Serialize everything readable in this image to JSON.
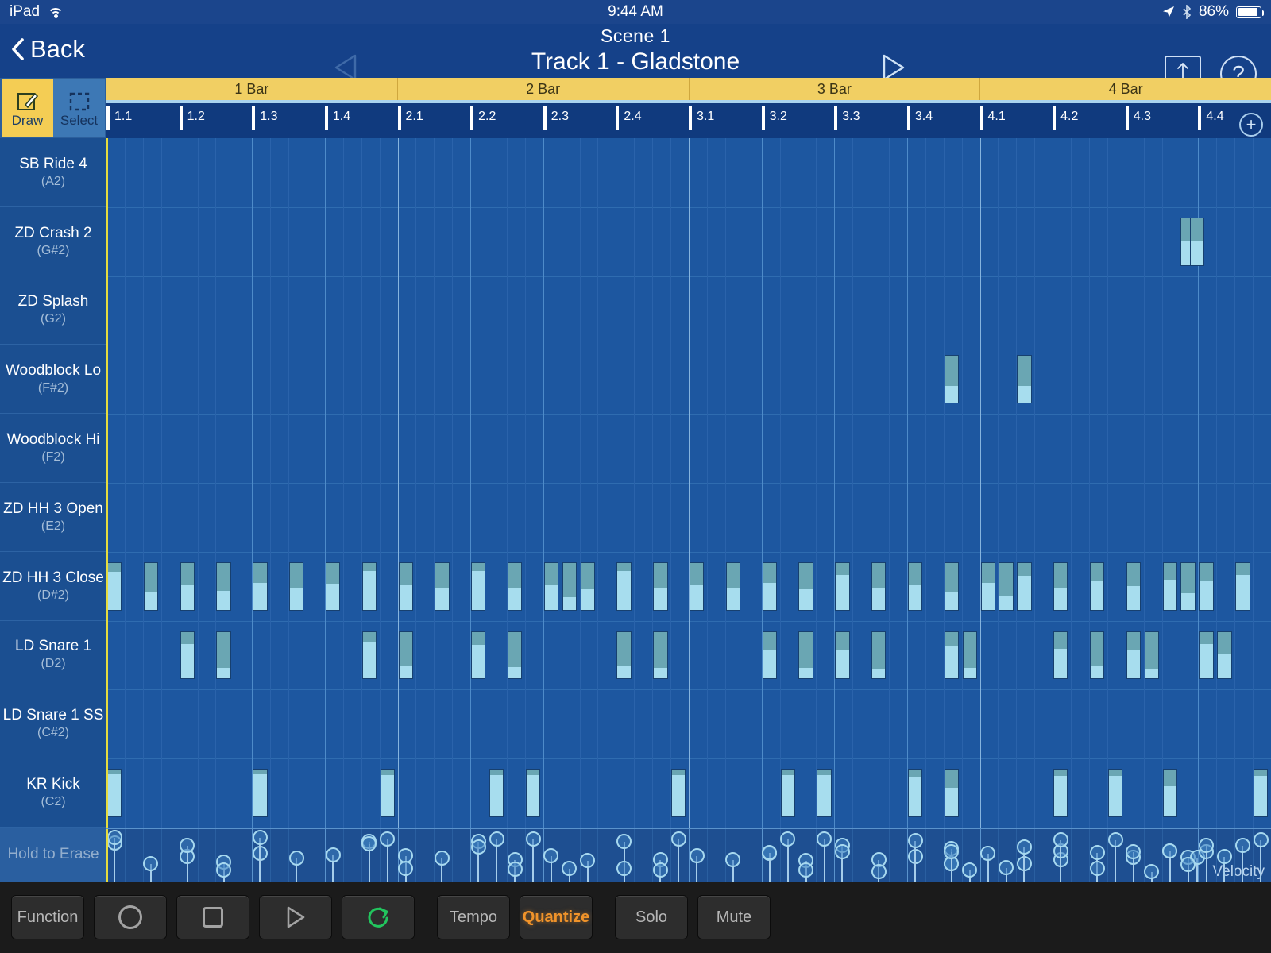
{
  "statusbar": {
    "device": "iPad",
    "wifi_icon": "wifi-icon",
    "time": "9:44 AM",
    "location_icon": "location-arrow-icon",
    "bluetooth_icon": "bluetooth-icon",
    "battery_percent": "86%",
    "battery_level": 86
  },
  "navbar": {
    "back_label": "Back",
    "back_icon": "chevron-left-icon",
    "scene_label": "Scene  1",
    "track_label": "Track 1 - Gladstone",
    "prev_icon": "triangle-left-icon",
    "next_icon": "triangle-right-icon",
    "resize_icon": "vertical-resize-icon",
    "help_icon": "question-mark-icon",
    "help_label": "?"
  },
  "tools": {
    "draw": {
      "label": "Draw",
      "icon": "pencil-square-icon",
      "active": true
    },
    "select": {
      "label": "Select",
      "icon": "dashed-square-icon",
      "active": false
    }
  },
  "ruler": {
    "bars": [
      "1 Bar",
      "2 Bar",
      "3 Bar",
      "4 Bar"
    ],
    "beats": [
      "1.1",
      "1.2",
      "1.3",
      "1.4",
      "2.1",
      "2.2",
      "2.3",
      "2.4",
      "3.1",
      "3.2",
      "3.3",
      "3.4",
      "4.1",
      "4.2",
      "4.3",
      "4.4"
    ],
    "add_label": "+",
    "add_icon": "plus-circle-icon"
  },
  "tracks": [
    {
      "name": "SB Ride 4",
      "note": "(A2)"
    },
    {
      "name": "ZD Crash 2",
      "note": "(G#2)"
    },
    {
      "name": "ZD Splash",
      "note": "(G2)"
    },
    {
      "name": "Woodblock Lo",
      "note": "(F#2)"
    },
    {
      "name": "Woodblock Hi",
      "note": "(F2)"
    },
    {
      "name": "ZD HH 3 Open",
      "note": "(E2)"
    },
    {
      "name": "ZD HH 3 Close",
      "note": "(D#2)"
    },
    {
      "name": "LD Snare 1",
      "note": "(D2)"
    },
    {
      "name": "LD Snare 1 SS",
      "note": "(C#2)"
    },
    {
      "name": "KR Kick",
      "note": "(C2)"
    }
  ],
  "velocity_lane": {
    "erase_label": "Hold to Erase",
    "axis_label": "Velocity"
  },
  "transport": {
    "function_label": "Function",
    "record_icon": "record-circle-icon",
    "stop_icon": "stop-square-icon",
    "play_icon": "play-triangle-icon",
    "loop_icon": "loop-arrow-icon",
    "tempo_label": "Tempo",
    "quantize_label": "Quantize",
    "solo_label": "Solo",
    "mute_label": "Mute"
  },
  "colors": {
    "accent_gold": "#f1cf63",
    "note_body": "#6aa6b3",
    "note_velocity": "#a7ddee",
    "grid_bg": "#1d57a0",
    "quantize_on": "#f0932a",
    "loop_on": "#22c55e",
    "playhead": "#e6dc3e"
  },
  "sequence": {
    "beats_total": 16,
    "steps_per_beat": 4,
    "playhead_step": 0,
    "notes": [
      {
        "track": 1,
        "step": 59,
        "dur": 1,
        "vel": 48
      },
      {
        "track": 1,
        "step": 59.5,
        "dur": 1,
        "vel": 48
      },
      {
        "track": 3,
        "step": 46,
        "dur": 1,
        "vel": 35
      },
      {
        "track": 3,
        "step": 50,
        "dur": 1,
        "vel": 35
      },
      {
        "track": 6,
        "step": 0,
        "dur": 1,
        "vel": 78
      },
      {
        "track": 6,
        "step": 2,
        "dur": 1,
        "vel": 36
      },
      {
        "track": 6,
        "step": 4,
        "dur": 1,
        "vel": 50
      },
      {
        "track": 6,
        "step": 6,
        "dur": 1,
        "vel": 38
      },
      {
        "track": 6,
        "step": 8,
        "dur": 1,
        "vel": 56
      },
      {
        "track": 6,
        "step": 10,
        "dur": 1,
        "vel": 46
      },
      {
        "track": 6,
        "step": 12,
        "dur": 1,
        "vel": 54
      },
      {
        "track": 6,
        "step": 14,
        "dur": 1,
        "vel": 80
      },
      {
        "track": 6,
        "step": 16,
        "dur": 1,
        "vel": 52
      },
      {
        "track": 6,
        "step": 18,
        "dur": 1,
        "vel": 46
      },
      {
        "track": 6,
        "step": 20,
        "dur": 1,
        "vel": 80
      },
      {
        "track": 6,
        "step": 22,
        "dur": 1,
        "vel": 44
      },
      {
        "track": 6,
        "step": 24,
        "dur": 1,
        "vel": 52
      },
      {
        "track": 6,
        "step": 25,
        "dur": 1,
        "vel": 26
      },
      {
        "track": 6,
        "step": 26,
        "dur": 1,
        "vel": 42
      },
      {
        "track": 6,
        "step": 28,
        "dur": 1,
        "vel": 80
      },
      {
        "track": 6,
        "step": 30,
        "dur": 1,
        "vel": 44
      },
      {
        "track": 6,
        "step": 32,
        "dur": 1,
        "vel": 52
      },
      {
        "track": 6,
        "step": 34,
        "dur": 1,
        "vel": 44
      },
      {
        "track": 6,
        "step": 36,
        "dur": 1,
        "vel": 56
      },
      {
        "track": 6,
        "step": 38,
        "dur": 1,
        "vel": 42
      },
      {
        "track": 6,
        "step": 40,
        "dur": 1,
        "vel": 72
      },
      {
        "track": 6,
        "step": 42,
        "dur": 1,
        "vel": 44
      },
      {
        "track": 6,
        "step": 44,
        "dur": 1,
        "vel": 50
      },
      {
        "track": 6,
        "step": 46,
        "dur": 1,
        "vel": 36
      },
      {
        "track": 6,
        "step": 48,
        "dur": 1,
        "vel": 56
      },
      {
        "track": 6,
        "step": 49,
        "dur": 1,
        "vel": 28
      },
      {
        "track": 6,
        "step": 50,
        "dur": 1,
        "vel": 70
      },
      {
        "track": 6,
        "step": 52,
        "dur": 1,
        "vel": 44
      },
      {
        "track": 6,
        "step": 54,
        "dur": 1,
        "vel": 58
      },
      {
        "track": 6,
        "step": 56,
        "dur": 1,
        "vel": 48
      },
      {
        "track": 6,
        "step": 58,
        "dur": 1,
        "vel": 62
      },
      {
        "track": 6,
        "step": 59,
        "dur": 1,
        "vel": 34
      },
      {
        "track": 6,
        "step": 60,
        "dur": 1,
        "vel": 60
      },
      {
        "track": 6,
        "step": 62,
        "dur": 1,
        "vel": 72
      },
      {
        "track": 7,
        "step": 4,
        "dur": 1,
        "vel": 72
      },
      {
        "track": 7,
        "step": 6,
        "dur": 1,
        "vel": 22
      },
      {
        "track": 7,
        "step": 14,
        "dur": 1,
        "vel": 76
      },
      {
        "track": 7,
        "step": 16,
        "dur": 1,
        "vel": 26
      },
      {
        "track": 7,
        "step": 20,
        "dur": 1,
        "vel": 70
      },
      {
        "track": 7,
        "step": 22,
        "dur": 1,
        "vel": 24
      },
      {
        "track": 7,
        "step": 28,
        "dur": 1,
        "vel": 26
      },
      {
        "track": 7,
        "step": 30,
        "dur": 1,
        "vel": 22
      },
      {
        "track": 7,
        "step": 36,
        "dur": 1,
        "vel": 58
      },
      {
        "track": 7,
        "step": 38,
        "dur": 1,
        "vel": 22
      },
      {
        "track": 7,
        "step": 40,
        "dur": 1,
        "vel": 60
      },
      {
        "track": 7,
        "step": 42,
        "dur": 1,
        "vel": 20
      },
      {
        "track": 7,
        "step": 46,
        "dur": 1,
        "vel": 66
      },
      {
        "track": 7,
        "step": 47,
        "dur": 1,
        "vel": 22
      },
      {
        "track": 7,
        "step": 52,
        "dur": 1,
        "vel": 62
      },
      {
        "track": 7,
        "step": 54,
        "dur": 1,
        "vel": 26
      },
      {
        "track": 7,
        "step": 56,
        "dur": 1,
        "vel": 60
      },
      {
        "track": 7,
        "step": 57,
        "dur": 1,
        "vel": 20
      },
      {
        "track": 7,
        "step": 60,
        "dur": 1,
        "vel": 72
      },
      {
        "track": 7,
        "step": 61,
        "dur": 1,
        "vel": 50
      },
      {
        "track": 9,
        "step": 0,
        "dur": 1,
        "vel": 88
      },
      {
        "track": 9,
        "step": 8,
        "dur": 1,
        "vel": 88
      },
      {
        "track": 9,
        "step": 15,
        "dur": 1,
        "vel": 86
      },
      {
        "track": 9,
        "step": 21,
        "dur": 1,
        "vel": 86
      },
      {
        "track": 9,
        "step": 23,
        "dur": 1,
        "vel": 86
      },
      {
        "track": 9,
        "step": 31,
        "dur": 1,
        "vel": 86
      },
      {
        "track": 9,
        "step": 37,
        "dur": 1,
        "vel": 86
      },
      {
        "track": 9,
        "step": 39,
        "dur": 1,
        "vel": 86
      },
      {
        "track": 9,
        "step": 44,
        "dur": 1,
        "vel": 82
      },
      {
        "track": 9,
        "step": 46,
        "dur": 1,
        "vel": 60
      },
      {
        "track": 9,
        "step": 52,
        "dur": 1,
        "vel": 84
      },
      {
        "track": 9,
        "step": 55,
        "dur": 1,
        "vel": 84
      },
      {
        "track": 9,
        "step": 58,
        "dur": 1,
        "vel": 62
      },
      {
        "track": 9,
        "step": 63,
        "dur": 1,
        "vel": 84
      }
    ]
  }
}
